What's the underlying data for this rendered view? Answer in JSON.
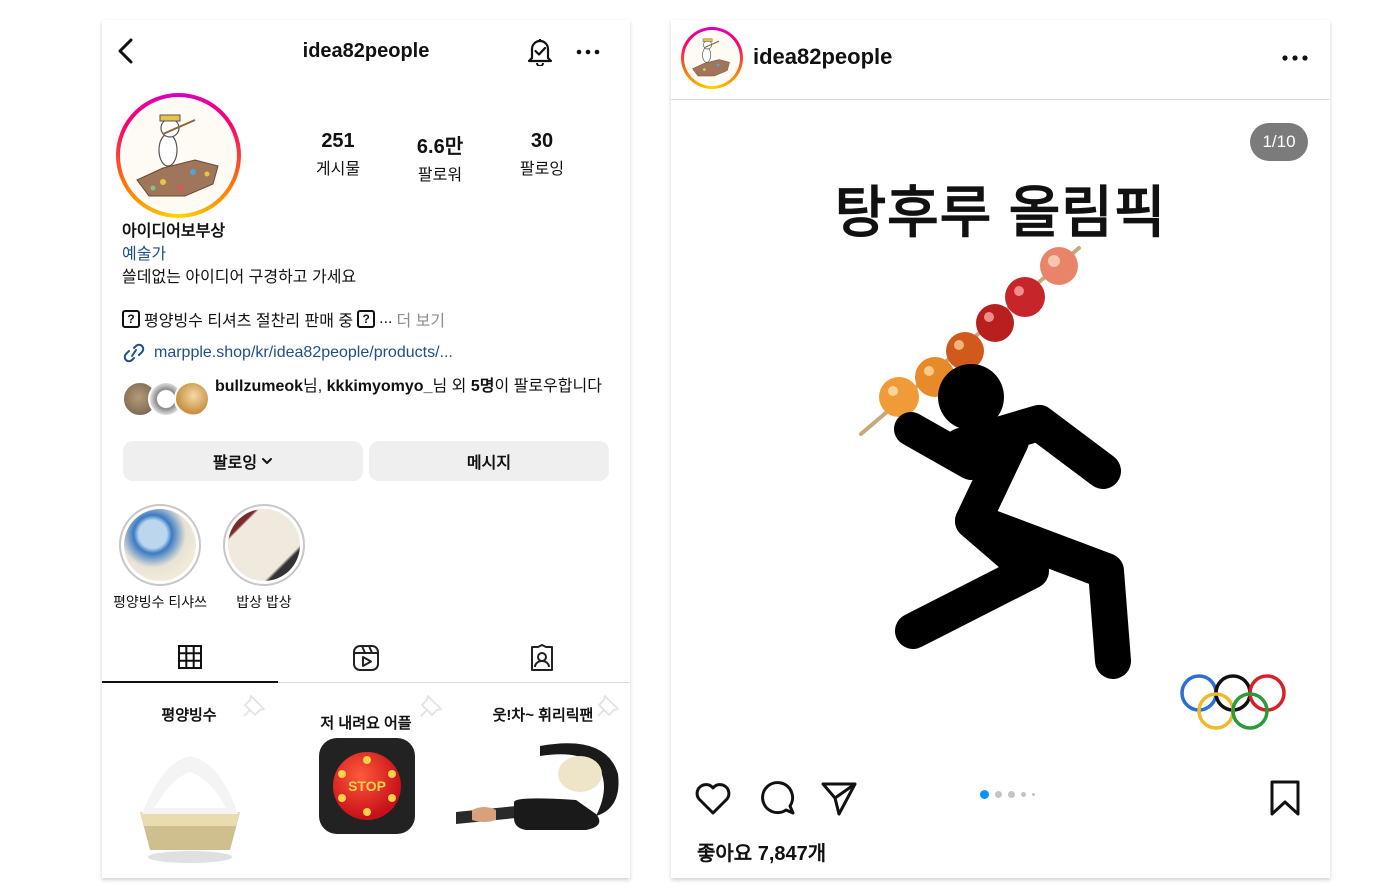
{
  "profile": {
    "username": "idea82people",
    "stats": [
      {
        "value": "251",
        "label": "게시물"
      },
      {
        "value": "6.6만",
        "label": "팔로워"
      },
      {
        "value": "30",
        "label": "팔로잉"
      }
    ],
    "display_name": "아이디어보부상",
    "category": "예술가",
    "bio_line1": "쓸데없는 아이디어 구경하고 가세요",
    "bio_line2": "평양빙수 티셔츠 절찬리 판매 중",
    "bio_qmark": "?",
    "bio_ellipsis": "...",
    "bio_more": "더 보기",
    "link": "marpple.shop/kr/idea82people/products/...",
    "followed_by": {
      "user1": "bullzumeok",
      "sep1": "님, ",
      "user2": "kkkimyomyo_",
      "sep2": "님 외 ",
      "count": "5명",
      "suffix": "이 팔로우합니다"
    },
    "buttons": {
      "following": "팔로잉",
      "message": "메시지"
    },
    "highlights": [
      {
        "label": "평양빙수 티샤쓰"
      },
      {
        "label": "밥상 밥상"
      }
    ],
    "grid": [
      {
        "title": "평양빙수"
      },
      {
        "title": "저 내려요 어플",
        "image_text": "STOP"
      },
      {
        "title": "웃!차~ 휘리릭팬"
      }
    ]
  },
  "post": {
    "username": "idea82people",
    "counter": "1/10",
    "title": "탕후루 올림픽",
    "likes": "좋아요 7,847개",
    "carousel_active_index": 0
  },
  "colors": {
    "link_blue": "#1f4f8a",
    "carousel_active": "#0095f6",
    "button_gray": "#efefef"
  },
  "icons": [
    "back-icon",
    "bell-icon",
    "more-icon",
    "link-icon",
    "grid-icon",
    "reels-icon",
    "tagged-icon",
    "pin-icon",
    "heart-icon",
    "comment-icon",
    "share-icon",
    "bookmark-icon",
    "chevron-down-icon"
  ]
}
